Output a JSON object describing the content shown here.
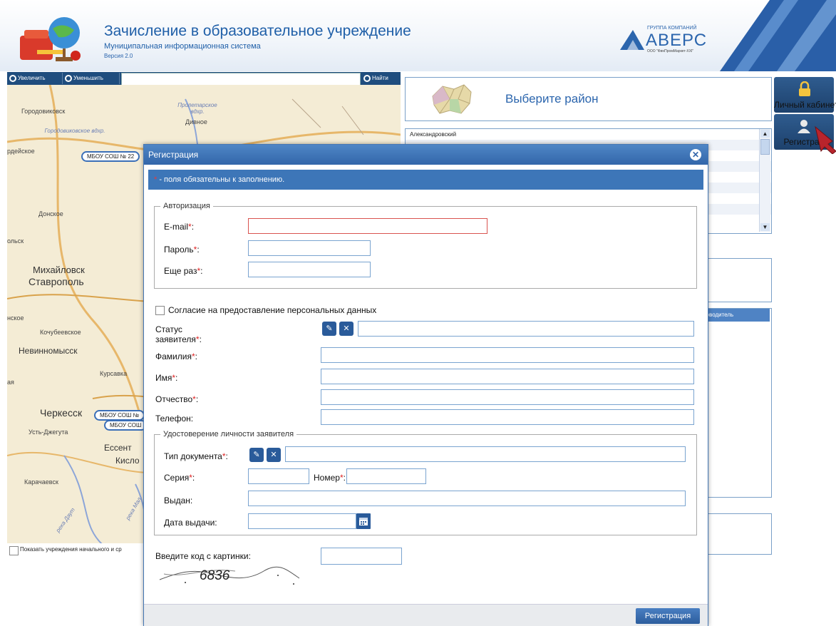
{
  "header": {
    "title": "Зачисление в образовательное учреждение",
    "subtitle": "Муниципальная информационная система",
    "version": "Версия 2.0",
    "brand_small": "ГРУППА КОМПАНИЙ",
    "brand_name": "АВЕРС",
    "brand_tiny": "ООО \"ФинПромМаркет-XXI\""
  },
  "map_toolbar": {
    "zoom_in": "Увеличить",
    "zoom_out": "Уменьшить",
    "search_value": "",
    "search_button": "Найти"
  },
  "map": {
    "labels": {
      "gorodovikovsk": "Городовиковск",
      "proletarskoe": "Пролетарское вдхр.",
      "gorodovikovskoe": "Городовиковское вдхр.",
      "divnoe": "Дивное",
      "ardeiskoe": "рдейское",
      "donskoe": "Донское",
      "lsk": "ольск",
      "mikhaylovsk": "Михайловск",
      "stavropol": "Ставрополь",
      "skoe": "нское",
      "kochubeevskoe": "Кочубеевское",
      "nevinnomyssk": "Невинномысск",
      "kursavka": "Курсавка",
      "aya": "ая",
      "cherkessk": "Черкесск",
      "ust_dzheguta": "Усть-Джегута",
      "essent": "Ессент",
      "kislo": "Кисло",
      "karachaevsk": "Карачаевск",
      "river": "река Даут",
      "river2": "река Мал"
    },
    "markers": {
      "m1": "МБОУ СОШ № 22",
      "m2": "МБОУ СОШ №",
      "m3": "МБОУ СОШ"
    },
    "footer_checkbox_label": "Показать учреждения начального и ср"
  },
  "district": {
    "header": "Выберите район",
    "items": [
      "Александровский",
      "",
      "",
      "",
      "",
      "",
      "",
      "",
      ""
    ]
  },
  "side_panel": {
    "box3_header": "ководитель"
  },
  "side_buttons": {
    "cabinet": "Личный кабинет",
    "register": "Регистрац"
  },
  "dialog": {
    "title": "Регистрация",
    "required_star": "*",
    "required_text": " - поля обязательны к заполнению.",
    "auth_legend": "Авторизация",
    "email_label": "E-mail",
    "password_label": "Пароль",
    "password_again_label": "Еще раз",
    "consent_label": "Согласие на предоставление персональных данных",
    "status_label_1": "Статус",
    "status_label_2": "заявителя",
    "surname_label": "Фамилия",
    "name_label": "Имя",
    "patronymic_label": "Отчество",
    "phone_label": "Телефон:",
    "id_legend": "Удостоверение личности заявителя",
    "doc_type_label": "Тип документа",
    "series_label": "Серия",
    "number_label": "Номер",
    "issued_label": "Выдан:",
    "issue_date_label": "Дата выдачи:",
    "captcha_label": "Введите код с картинки:",
    "captcha_text": "6836",
    "submit": "Регистрация",
    "star": "*",
    "colon": ":"
  },
  "colors": {
    "accent": "#2b65ad",
    "dialog_title": "#3d76b8",
    "required": "#d22222"
  }
}
